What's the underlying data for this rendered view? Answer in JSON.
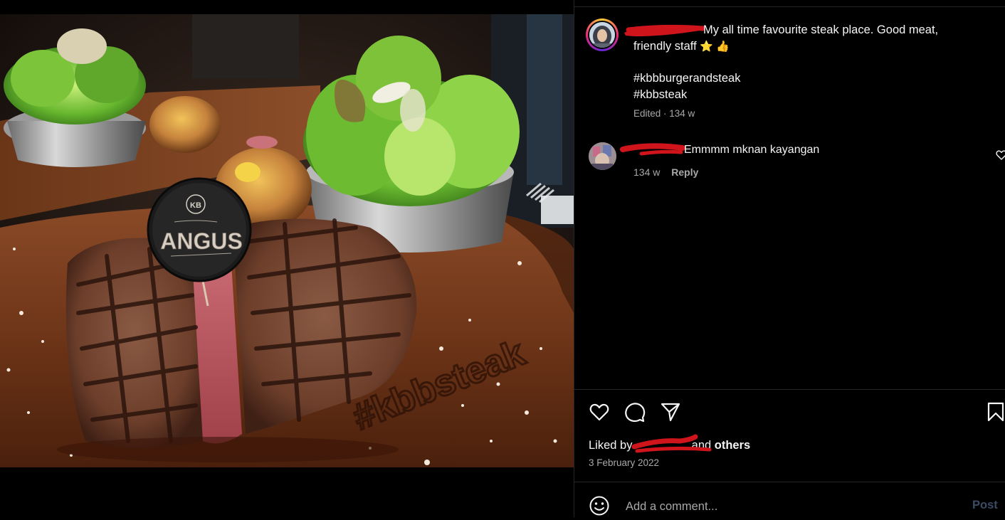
{
  "photo": {
    "sign_text": "ANGUS",
    "sign_logo": "KB",
    "board_engraving": "#kbbsteak"
  },
  "post": {
    "caption_text": "My all time favourite steak place. Good meat,",
    "caption_line2": "friendly staff",
    "caption_emojis": "⭐ 👍",
    "hashtag1": "#kbbburgerandsteak",
    "hashtag2": "#kbbsteak",
    "edited_meta": "Edited · 134 w"
  },
  "comment": {
    "text": "Emmmm mknan kayangan",
    "age": "134 w",
    "reply_label": "Reply"
  },
  "actions": {
    "liked_by_prefix": "Liked by",
    "liked_by_and": "and",
    "liked_by_others": "others",
    "date": "3 February 2022"
  },
  "composer": {
    "placeholder": "Add a comment...",
    "post_label": "Post"
  },
  "colors": {
    "redaction": "#d0141b",
    "post_button": "#3b4a63",
    "muted_text": "#a8a8a8"
  }
}
